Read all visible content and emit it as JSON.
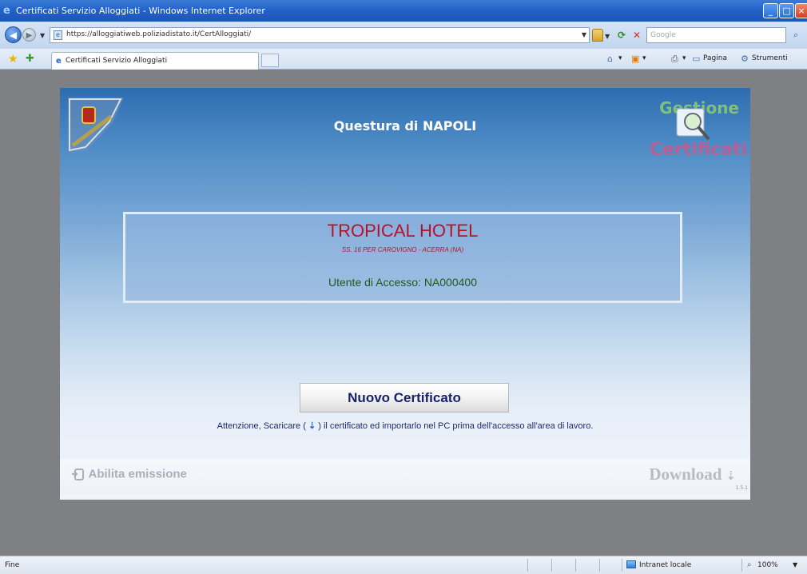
{
  "window": {
    "title": "Certificati Servizio Alloggiati - Windows Internet Explorer",
    "min_glyph": "_",
    "max_glyph": "□",
    "close_glyph": "×"
  },
  "address": {
    "url": "https://alloggiatiweb.poliziadistato.it/CertAlloggiati/"
  },
  "search": {
    "placeholder": "Google"
  },
  "tab": {
    "label": "Certificati Servizio Alloggiati"
  },
  "toolbar": {
    "home_label": "▾",
    "feeds_label": "▾",
    "print_label": "▾",
    "page_label": "Pagina",
    "tools_label": "Strumenti"
  },
  "page": {
    "title": "Questura di NAPOLI",
    "hotel_name": "TROPICAL HOTEL",
    "hotel_address": "SS. 16 PER CAROVIGNO - ACERRA (NA)",
    "access_user": "Utente di Accesso: NA000400",
    "new_certificate_button": "Nuovo Certificato",
    "warning_before": "Attenzione, Scaricare (",
    "warning_icon": "⇣",
    "warning_after": ") il certificato ed importarlo nel PC prima dell'accesso all'area di lavoro.",
    "abilita_label": "Abilita emissione",
    "download_label": "Download",
    "download_icon": "⇣",
    "version": "1.5.1",
    "gestione_top": "Gestione",
    "gestione_bottom": "Certificati"
  },
  "status": {
    "text": "Fine",
    "zone": "Intranet locale",
    "zoom": "100%"
  },
  "colors": {
    "hotel_red": "#b3142a",
    "access_green": "#1f5a1a",
    "button_text": "#16236b",
    "panel_top": "#2d6db0"
  },
  "icons": [
    "ie-icon",
    "back-icon",
    "forward-icon",
    "lock-icon",
    "refresh-icon",
    "stop-icon",
    "search-icon",
    "favorites-star-icon",
    "add-favorite-icon",
    "home-icon",
    "feeds-icon",
    "print-icon",
    "page-icon",
    "tools-icon",
    "crest-icon",
    "gestione-certificati-logo",
    "abilita-icon",
    "download-icon",
    "zone-icon",
    "zoom-icon"
  ]
}
